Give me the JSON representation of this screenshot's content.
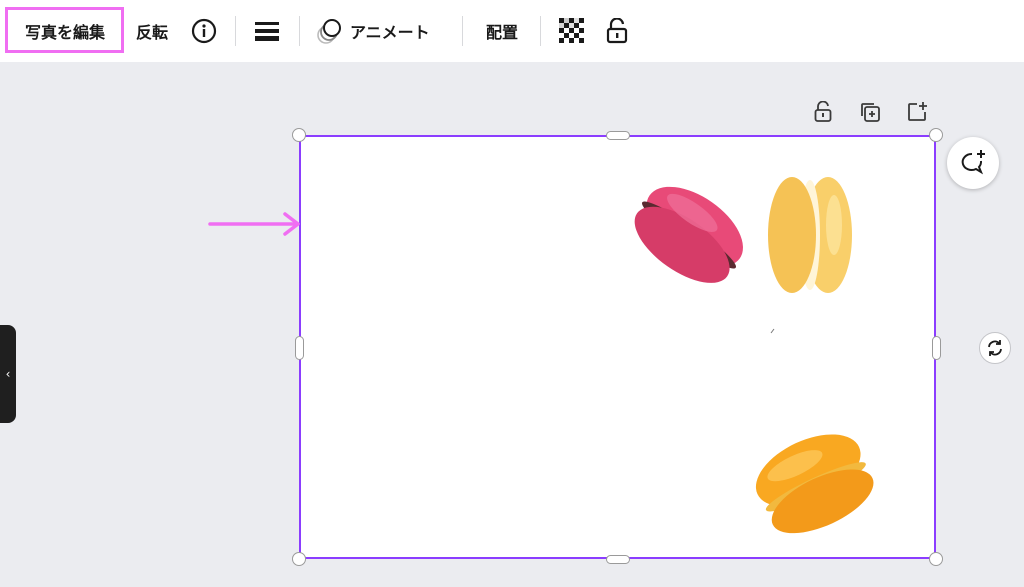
{
  "toolbar": {
    "edit_photo": "写真を編集",
    "flip": "反転",
    "info_icon": "info-icon",
    "lines_icon": "line-weight-icon",
    "animate": "アニメート",
    "position": "配置",
    "transparency_icon": "transparency-icon",
    "lock_icon": "lock-icon"
  },
  "canvas": {
    "page_actions": [
      "lock-icon",
      "duplicate-page-icon",
      "add-page-icon"
    ],
    "comment_icon": "add-comment-icon",
    "rotate_icon": "rotate-icon",
    "side_tab_glyph": "‹"
  },
  "annotation": {
    "arrow_color": "#f06ef2"
  },
  "colors": {
    "selection": "#8b3dff",
    "highlight": "#f06ef2"
  },
  "image": {
    "content": "macarons"
  }
}
